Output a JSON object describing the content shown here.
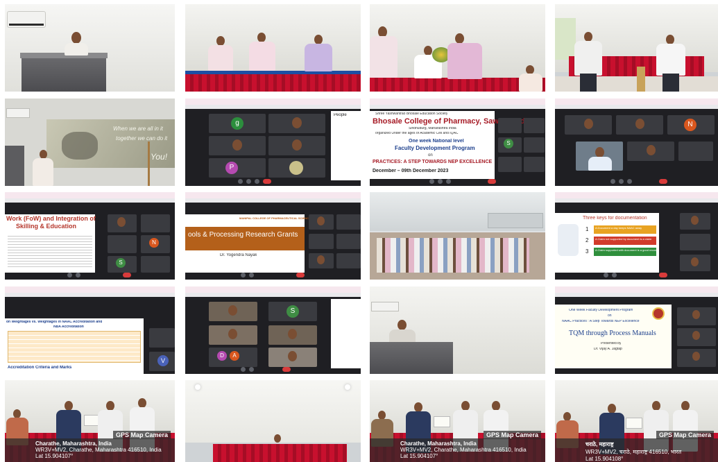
{
  "collage": {
    "grid_label": "FDP photo collage"
  },
  "fdp_banner": {
    "society": "Shree Yashwantrao Bhosale Education Society",
    "college": "Bhosale College of Pharmacy, Sawantwadi",
    "address": "Sindhudurg, Maharashtra India",
    "organized": "organized Under the ages of Academic Cell and IQAC",
    "event": "One week National level",
    "program": "Faculty Development Program",
    "on": "on",
    "theme": "PRACTICES: A STEP TOWARDS NEP EXCELLENCE",
    "dates": "December – 09th December 2023"
  },
  "fow_slide": {
    "title_1": "Work (FoW) and Integration of",
    "title_2": "Skilling & Education"
  },
  "research_slide": {
    "logo": "MANIPAL COLLEGE OF PHARMACEUTICAL SCIENCES",
    "title": "ools & Processing Research Grants",
    "speaker": "Dr. Yogendra Nayak"
  },
  "keys_slide": {
    "title": "Three keys for documentation",
    "k1": "A Document a day keeps NAAC away",
    "k2": "A Claim not supported by document is a claim",
    "k3": "A Claim supported with document is a good record"
  },
  "naac_slide": {
    "title_a": "on Weightages vs. Weightages in NAAC Accreditation and",
    "title_b": "NBA Accreditation",
    "footer": "Accreditation Criteria and Marks"
  },
  "tqm_slide": {
    "line1": "One Week Faculty Development Program",
    "line2": "on",
    "line3": "NAAC Practices : A Step Towards NEP Excellence",
    "title": "TQM through Process Manuals",
    "presented": "Presented by",
    "speaker": "Dr. Vijay A. Jagtap"
  },
  "gps": {
    "header": "GPS Map Camera",
    "place": "Charathe, Maharashtra, India",
    "addr": "WR3V+MV2, Charathe, Maharashtra 416510, India",
    "lat": "Lat 15.904107°",
    "place_mr": "चराठे, महाराष्ट्र",
    "addr_mr": "WR3V+MV2, चराठे, महाराष्ट्र 416510, भारत",
    "lat_mr": "Lat 15.904108°"
  },
  "zoom": {
    "people_label": "People",
    "tiles": {
      "g": "g",
      "n": "N",
      "s": "S",
      "v": "V",
      "d": "D",
      "a": "A",
      "p": "P"
    }
  },
  "projector": {
    "line1": "When we are all in it",
    "line2": "together we can do it",
    "line3": "You!"
  },
  "colors": {
    "curtain": "#c8102e",
    "zoom_bg": "#1f1f23",
    "end_call": "#d93b3b"
  }
}
